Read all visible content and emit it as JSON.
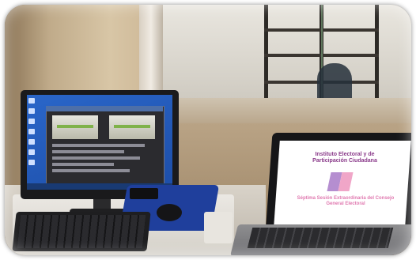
{
  "photo": {
    "laptop_slide": {
      "title": "Instituto Electoral y de Participación Ciudadana",
      "subtitle": "Séptima Sesión Extraordinaria del Consejo General Electoral"
    }
  }
}
